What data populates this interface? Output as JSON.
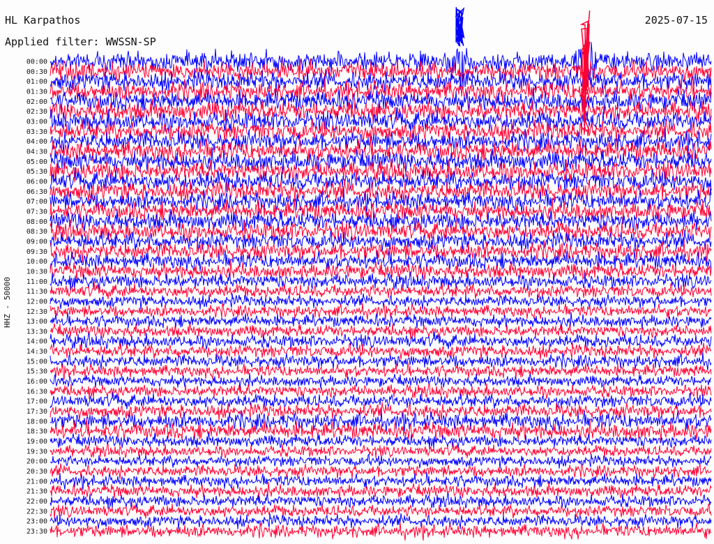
{
  "header": {
    "station": "HL Karpathos",
    "date": "2025-07-15",
    "filter": "Applied filter: WWSSN-SP"
  },
  "chart_data": {
    "type": "line",
    "title": "HL Karpathos",
    "subtitle": "Applied filter: WWSSN-SP",
    "ylabel": "HHZ - 50000",
    "xlabel": "",
    "y_tick_labels": [
      "00:00",
      "00:30",
      "01:00",
      "01:30",
      "02:00",
      "02:30",
      "03:00",
      "03:30",
      "04:00",
      "04:30",
      "05:00",
      "05:30",
      "06:00",
      "06:30",
      "07:00",
      "07:30",
      "08:00",
      "08:30",
      "09:00",
      "09:30",
      "10:00",
      "10:30",
      "11:00",
      "11:30",
      "12:00",
      "12:30",
      "13:00",
      "13:30",
      "14:00",
      "14:30",
      "15:00",
      "15:30",
      "16:00",
      "16:30",
      "17:00",
      "17:30",
      "18:00",
      "18:30",
      "19:00",
      "19:30",
      "20:00",
      "20:30",
      "21:00",
      "21:30",
      "22:00",
      "22:30",
      "23:00",
      "23:30"
    ],
    "trace_colors": [
      "#0000ff",
      "#ff0033"
    ],
    "x_range_minutes": [
      0,
      30
    ],
    "noise_amplitude_by_row": [
      0.95,
      0.95,
      0.95,
      0.95,
      0.95,
      0.95,
      0.95,
      0.95,
      0.95,
      0.95,
      0.95,
      0.95,
      0.95,
      0.95,
      0.9,
      0.9,
      0.9,
      0.9,
      0.85,
      0.85,
      0.8,
      0.75,
      0.7,
      0.65,
      0.6,
      0.6,
      0.6,
      0.6,
      0.65,
      0.65,
      0.65,
      0.6,
      0.55,
      0.6,
      0.65,
      0.7,
      0.8,
      0.8,
      0.6,
      0.55,
      0.55,
      0.6,
      0.6,
      0.6,
      0.6,
      0.6,
      0.6,
      0.65
    ],
    "events": [
      {
        "time": "00:00",
        "minute": 18.6,
        "amplitude": 3.5,
        "color": "#0000ff"
      },
      {
        "time": "00:00",
        "minute": 24.3,
        "amplitude": 4.0,
        "color": "#ff0033"
      }
    ]
  }
}
